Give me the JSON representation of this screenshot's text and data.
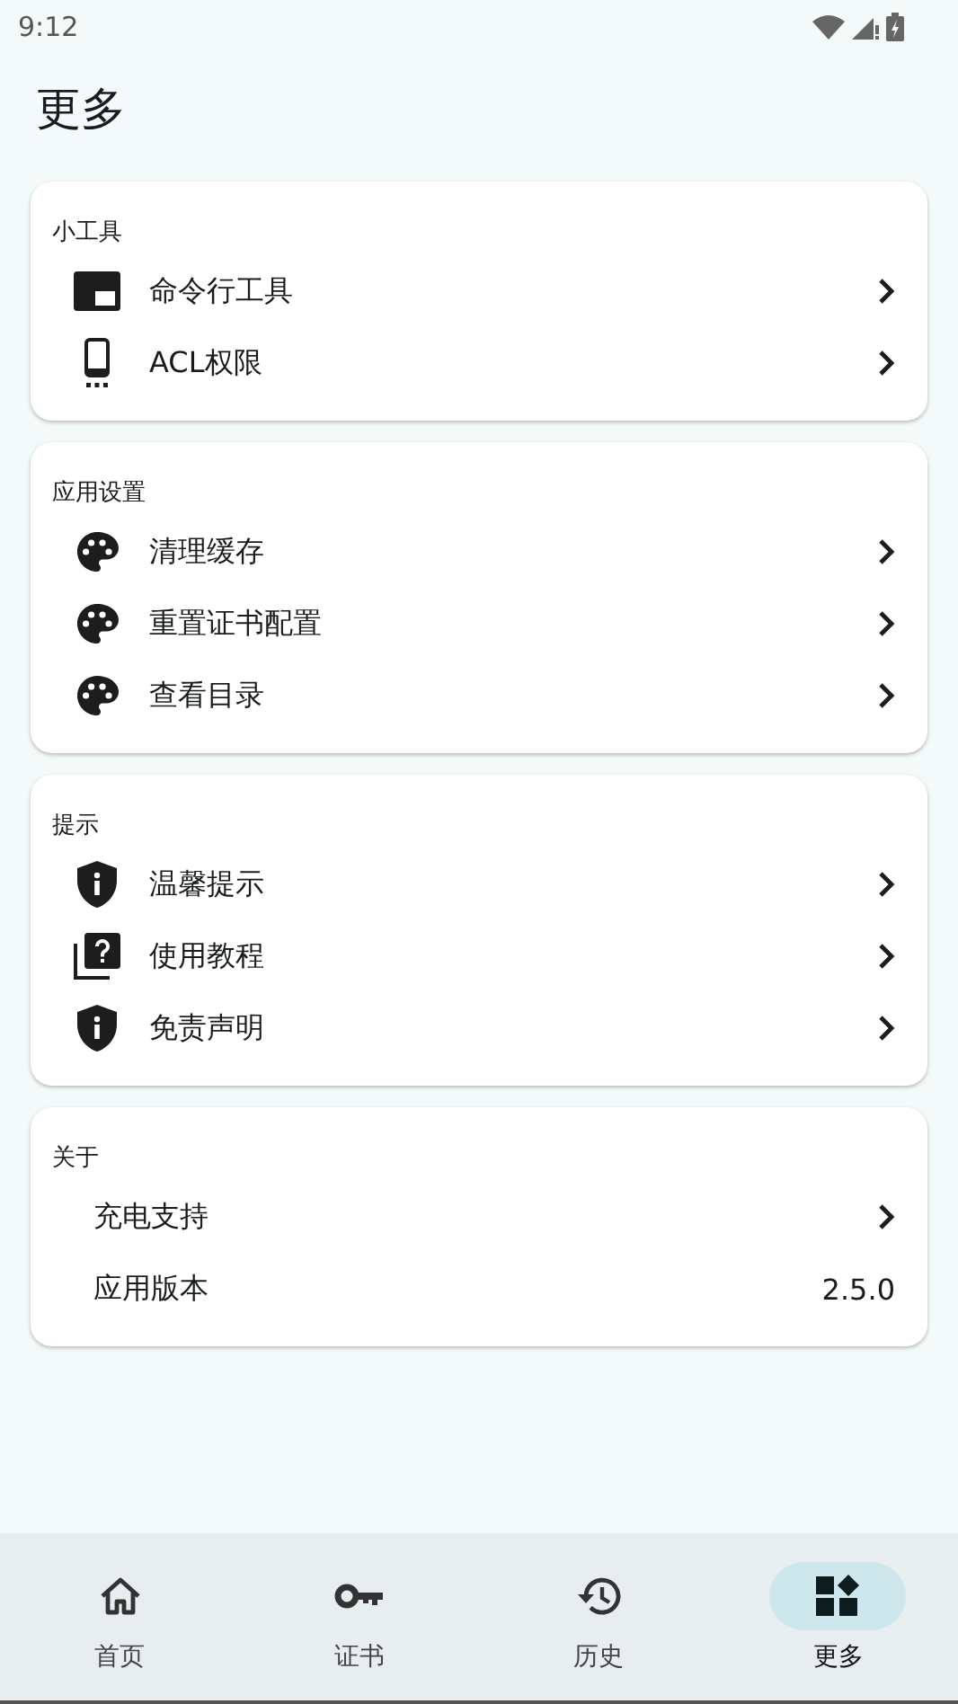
{
  "status_bar": {
    "time": "9:12"
  },
  "title": "更多",
  "sections": [
    {
      "header": "小工具",
      "items": [
        {
          "kind": "terminal",
          "label": "命令行工具"
        },
        {
          "kind": "phone",
          "label": "ACL权限"
        }
      ]
    },
    {
      "header": "应用设置",
      "items": [
        {
          "kind": "palette",
          "label": "清理缓存"
        },
        {
          "kind": "palette",
          "label": "重置证书配置"
        },
        {
          "kind": "palette",
          "label": "查看目录"
        }
      ]
    },
    {
      "header": "提示",
      "items": [
        {
          "kind": "shield",
          "label": "温馨提示"
        },
        {
          "kind": "help",
          "label": "使用教程"
        },
        {
          "kind": "shield",
          "label": "免责声明"
        }
      ]
    },
    {
      "header": "关于",
      "items": [
        {
          "kind": "plain",
          "label": "充电支持"
        },
        {
          "kind": "plain",
          "label": "应用版本",
          "value": "2.5.0"
        }
      ]
    }
  ],
  "nav": [
    {
      "kind": "home",
      "label": "首页",
      "selected": false
    },
    {
      "kind": "key",
      "label": "证书",
      "selected": false
    },
    {
      "kind": "history",
      "label": "历史",
      "selected": false
    },
    {
      "kind": "widgets",
      "label": "更多",
      "selected": true
    }
  ]
}
